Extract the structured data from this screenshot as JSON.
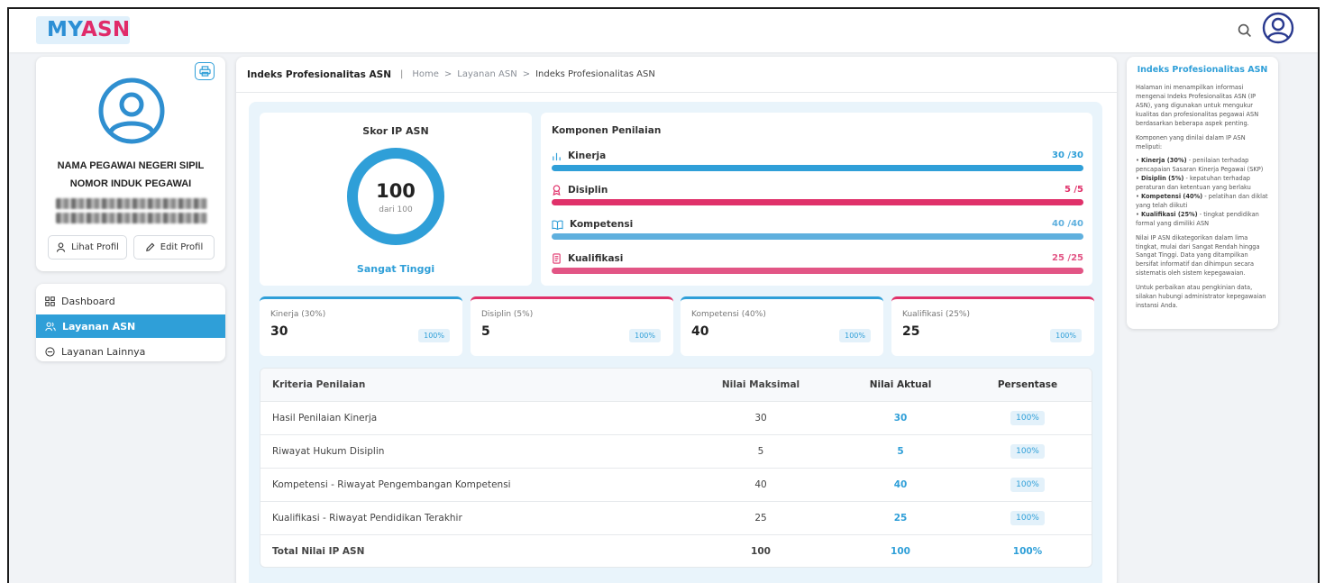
{
  "app": {
    "logo_my": "MY",
    "logo_asn": "ASN"
  },
  "topbar": {
    "search_icon": "search-icon",
    "account_icon": "user-circle-icon"
  },
  "profile": {
    "name": "NAMA PEGAWAI NEGERI SIPIL",
    "nip_label": "NOMOR INDUK PEGAWAI",
    "view_button": "Lihat Profil",
    "edit_button": "Edit Profil"
  },
  "nav": {
    "items": [
      {
        "label": "Dashboard",
        "icon": "grid-icon",
        "active": false
      },
      {
        "label": "Layanan ASN",
        "icon": "users-icon",
        "active": true
      },
      {
        "label": "Layanan Lainnya",
        "icon": "minus-circle-icon",
        "active": false
      }
    ]
  },
  "breadcrumb": {
    "title": "Indeks Profesionalitas ASN",
    "items": [
      "Home",
      "Layanan ASN",
      "Indeks Profesionalitas ASN"
    ]
  },
  "score": {
    "title": "Skor IP ASN",
    "value": "100",
    "sub": "dari 100",
    "category": "Sangat Tinggi",
    "fill_fraction": 1.0
  },
  "components": {
    "title": "Komponen Penilaian",
    "items": [
      {
        "label": "Kinerja",
        "score": "30 /30",
        "fraction": 1.0,
        "icon": "bar-chart-icon",
        "color": "#2f9fd8"
      },
      {
        "label": "Disiplin",
        "score": "5 /5",
        "fraction": 1.0,
        "icon": "award-icon",
        "color": "#e0316a"
      },
      {
        "label": "Kompetensi",
        "score": "40 /40",
        "fraction": 1.0,
        "icon": "book-icon",
        "color": "#5fb0de"
      },
      {
        "label": "Kualifikasi",
        "score": "25 /25",
        "fraction": 1.0,
        "icon": "scroll-icon",
        "color": "#e25585"
      }
    ]
  },
  "stats": [
    {
      "label": "Kinerja (30%)",
      "value": "30",
      "badge": "100%",
      "color": "#2f9fd8"
    },
    {
      "label": "Disiplin (5%)",
      "value": "5",
      "badge": "100%",
      "color": "#e0316a"
    },
    {
      "label": "Kompetensi (40%)",
      "value": "40",
      "badge": "100%",
      "color": "#2f9fd8"
    },
    {
      "label": "Kualifikasi (25%)",
      "value": "25",
      "badge": "100%",
      "color": "#e0316a"
    }
  ],
  "table": {
    "headers": [
      "Kriteria Penilaian",
      "Nilai Maksimal",
      "Nilai Aktual",
      "Persentase"
    ],
    "rows": [
      [
        "Hasil Penilaian Kinerja",
        "30",
        "30",
        "100%"
      ],
      [
        "Riwayat Hukum Disiplin",
        "5",
        "5",
        "100%"
      ],
      [
        "Kompetensi - Riwayat Pengembangan Kompetensi",
        "40",
        "40",
        "100%"
      ],
      [
        "Kualifikasi - Riwayat Pendidikan Terakhir",
        "25",
        "25",
        "100%"
      ]
    ],
    "total": [
      "Total Nilai IP ASN",
      "100",
      "100",
      "100%"
    ]
  },
  "info": {
    "title": "Indeks Profesionalitas ASN",
    "intro": "Halaman ini menampilkan informasi mengenai Indeks Profesionalitas ASN (IP ASN), yang digunakan untuk mengukur kualitas dan profesionalitas pegawai ASN berdasarkan beberapa aspek penting.",
    "list_intro": "Komponen yang dinilai dalam IP ASN meliputi:",
    "points": [
      {
        "bold": "Kinerja (30%)",
        "text": " - penilaian terhadap pencapaian Sasaran Kinerja Pegawai (SKP)"
      },
      {
        "bold": "Disiplin (5%)",
        "text": " - kepatuhan terhadap peraturan dan ketentuan yang berlaku"
      },
      {
        "bold": "Kompetensi (40%)",
        "text": " - pelatihan dan diklat yang telah diikuti"
      },
      {
        "bold": "Kualifikasi (25%)",
        "text": " - tingkat pendidikan formal yang dimiliki ASN"
      }
    ],
    "para2": "Nilai IP ASN dikategorikan dalam lima tingkat, mulai dari Sangat Rendah hingga Sangat Tinggi. Data yang ditampilkan bersifat informatif dan dihimpun secara sistematis oleh sistem kepegawaian.",
    "para3": "Untuk perbaikan atau pengkinian data, silakan hubungi administrator kepegawaian instansi Anda."
  }
}
